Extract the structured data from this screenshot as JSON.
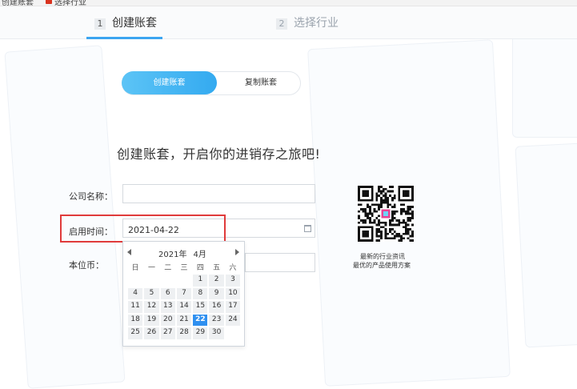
{
  "bookmarks": [
    {
      "label": "创建账套",
      "icon": "bookmark-icon"
    },
    {
      "label": "选择行业",
      "icon": "bookmark-icon"
    }
  ],
  "steps": [
    {
      "num": "1",
      "label": "创建账套",
      "active": true
    },
    {
      "num": "2",
      "label": "选择行业",
      "active": false
    }
  ],
  "toggle": {
    "active_label": "创建账套",
    "other_label": "复制账套"
  },
  "slogan": "创建账套，开启你的进销存之旅吧!",
  "form": {
    "company_label": "公司名称：",
    "company_value": "",
    "start_label": "启用时间：",
    "start_value": "2021-04-22",
    "currency_label": "本位币："
  },
  "calendar": {
    "year": "2021年",
    "month": "4月",
    "weekdays": [
      "日",
      "一",
      "二",
      "三",
      "四",
      "五",
      "六"
    ],
    "leading_blanks": 4,
    "days": [
      "1",
      "2",
      "3",
      "4",
      "5",
      "6",
      "7",
      "8",
      "9",
      "10",
      "11",
      "12",
      "13",
      "14",
      "15",
      "16",
      "17",
      "18",
      "19",
      "20",
      "21",
      "22",
      "23",
      "24",
      "25",
      "26",
      "27",
      "28",
      "29",
      "30"
    ],
    "selected": "22"
  },
  "qr": {
    "line1": "最新的行业资讯",
    "line2": "最优的产品使用方案"
  },
  "colors": {
    "accent": "#3ca5f0",
    "selected_day": "#2f90f0",
    "highlight": "#e03b3b"
  }
}
